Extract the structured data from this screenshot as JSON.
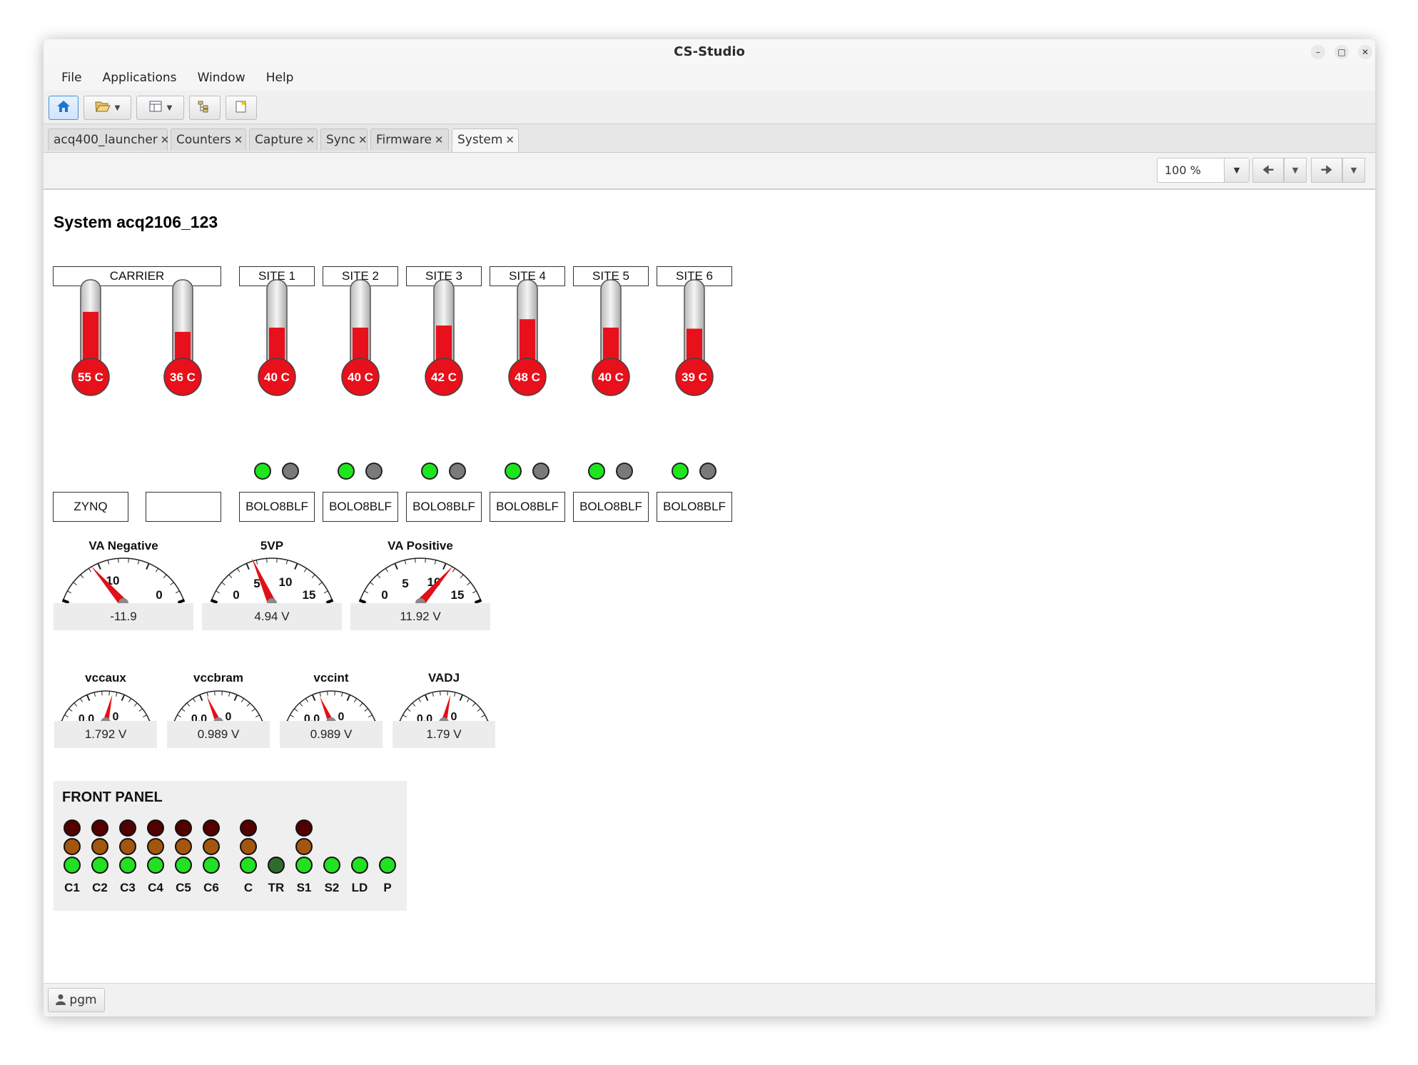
{
  "window": {
    "title": "CS-Studio"
  },
  "menu": [
    "File",
    "Applications",
    "Window",
    "Help"
  ],
  "tabs": [
    {
      "label": "acq400_launcher",
      "active": false
    },
    {
      "label": "Counters",
      "active": false
    },
    {
      "label": "Capture",
      "active": false
    },
    {
      "label": "Sync",
      "active": false
    },
    {
      "label": "Firmware",
      "active": false
    },
    {
      "label": "System",
      "active": true
    }
  ],
  "zoom": {
    "value": "100 %"
  },
  "page": {
    "title": "System acq2106_123"
  },
  "columns": [
    {
      "header": "CARRIER",
      "temps": [
        {
          "value": 55,
          "label": "55 C",
          "name": "ZYNQ"
        },
        {
          "value": 36,
          "label": "36 C",
          "name": ""
        }
      ]
    },
    {
      "header": "SITE 1",
      "temp": {
        "value": 40,
        "label": "40 C"
      },
      "name": "BOLO8BLF",
      "leds": [
        "on",
        "off"
      ]
    },
    {
      "header": "SITE 2",
      "temp": {
        "value": 40,
        "label": "40 C"
      },
      "name": "BOLO8BLF",
      "leds": [
        "on",
        "off"
      ]
    },
    {
      "header": "SITE 3",
      "temp": {
        "value": 42,
        "label": "42 C"
      },
      "name": "BOLO8BLF",
      "leds": [
        "on",
        "off"
      ]
    },
    {
      "header": "SITE 4",
      "temp": {
        "value": 48,
        "label": "48 C"
      },
      "name": "BOLO8BLF",
      "leds": [
        "on",
        "off"
      ]
    },
    {
      "header": "SITE 5",
      "temp": {
        "value": 40,
        "label": "40 C"
      },
      "name": "BOLO8BLF",
      "leds": [
        "on",
        "off"
      ]
    },
    {
      "header": "SITE 6",
      "temp": {
        "value": 39,
        "label": "39 C"
      },
      "name": "BOLO8BLF",
      "leds": [
        "on",
        "off"
      ]
    }
  ],
  "big_meters": [
    {
      "title": "VA Negative",
      "readout": "-11.9",
      "value": -11.9,
      "min": -15,
      "max": 0,
      "ticks": [
        "10",
        "0"
      ]
    },
    {
      "title": "5VP",
      "readout": "4.94 V",
      "value": 4.94,
      "min": 0,
      "max": 15,
      "ticks": [
        "0",
        "5",
        "10",
        "15"
      ]
    },
    {
      "title": "VA Positive",
      "readout": "11.92 V",
      "value": 11.92,
      "min": 0,
      "max": 15,
      "ticks": [
        "0",
        "5",
        "10",
        "15"
      ]
    }
  ],
  "small_meters": [
    {
      "title": "vccaux",
      "readout": "1.792 V",
      "value": 1.792,
      "min": 0,
      "max": 3,
      "ticks": [
        "0.0",
        "0"
      ]
    },
    {
      "title": "vccbram",
      "readout": "0.989 V",
      "value": 0.989,
      "min": 0,
      "max": 3,
      "ticks": [
        "0.0",
        "0"
      ]
    },
    {
      "title": "vccint",
      "readout": "0.989 V",
      "value": 0.989,
      "min": 0,
      "max": 3,
      "ticks": [
        "0.0",
        "0"
      ]
    },
    {
      "title": "VADJ",
      "readout": "1.79 V",
      "value": 1.79,
      "min": 0,
      "max": 3,
      "ticks": [
        "0.0",
        "0"
      ]
    }
  ],
  "front_panel": {
    "title": "FRONT PANEL",
    "channels": [
      {
        "label": "C1",
        "leds": [
          "#520000",
          "#a3560d",
          "#22e022"
        ]
      },
      {
        "label": "C2",
        "leds": [
          "#520000",
          "#a3560d",
          "#22e022"
        ]
      },
      {
        "label": "C3",
        "leds": [
          "#520000",
          "#a3560d",
          "#22e022"
        ]
      },
      {
        "label": "C4",
        "leds": [
          "#520000",
          "#a3560d",
          "#22e022"
        ]
      },
      {
        "label": "C5",
        "leds": [
          "#520000",
          "#a3560d",
          "#22e022"
        ]
      },
      {
        "label": "C6",
        "leds": [
          "#520000",
          "#a3560d",
          "#22e022"
        ]
      },
      {
        "label": "C",
        "leds": [
          "#520000",
          "#a3560d",
          "#22e022"
        ]
      },
      {
        "label": "TR",
        "leds": [
          null,
          null,
          "#2f6b2f"
        ]
      },
      {
        "label": "S1",
        "leds": [
          "#520000",
          "#a3560d",
          "#22e022"
        ]
      },
      {
        "label": "S2",
        "leds": [
          null,
          null,
          "#22e022"
        ]
      },
      {
        "label": "LD",
        "leds": [
          null,
          null,
          "#22e022"
        ]
      },
      {
        "label": "P",
        "leds": [
          null,
          null,
          "#22e022"
        ]
      }
    ]
  },
  "colors": {
    "led_on": "#1ee61e",
    "led_off": "#7a7a7a",
    "therm_fill": "#e8101a",
    "needle": "#e0101a"
  },
  "status": {
    "user": "pgm"
  }
}
